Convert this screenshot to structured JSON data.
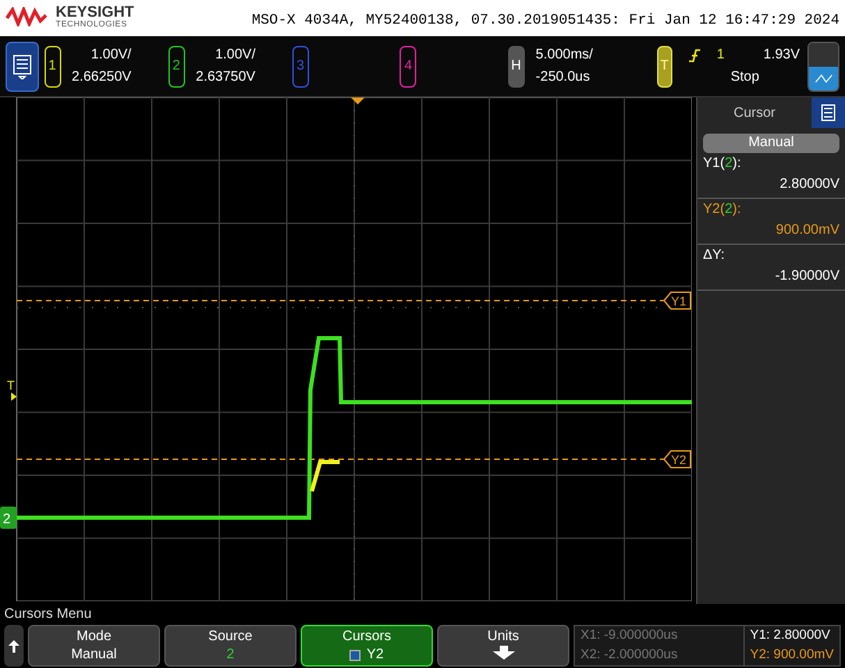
{
  "header": {
    "brand": "KEYSIGHT",
    "brand_sub": "TECHNOLOGIES",
    "title": "MSO-X 4034A, MY52400138, 07.30.2019051435: Fri Jan 12 16:47:29 2024"
  },
  "channels": [
    {
      "label": "1",
      "scale": "1.00V/",
      "offset": "2.66250V",
      "color": "#d8d800"
    },
    {
      "label": "2",
      "scale": "1.00V/",
      "offset": "2.63750V",
      "color": "#22c422"
    },
    {
      "label": "3",
      "color": "#3050e0"
    },
    {
      "label": "4",
      "color": "#e020a0"
    }
  ],
  "horizontal": {
    "label": "H",
    "scale": "5.000ms/",
    "delay": "-250.0us"
  },
  "trigger": {
    "label": "T",
    "source": "1",
    "level": "1.93V",
    "status": "Stop"
  },
  "plot": {
    "trigger_marker": "T",
    "ground_marker": "2",
    "cursors": [
      {
        "label": "Y1"
      },
      {
        "label": "Y2"
      }
    ]
  },
  "side_panel": {
    "title": "Cursor",
    "mode": "Manual",
    "readouts": [
      {
        "label": "Y1(",
        "source": "2",
        "close": "):",
        "value": "2.80000V",
        "color": "#ffffff"
      },
      {
        "label": "Y2(",
        "source": "2",
        "close": "):",
        "value": "900.00mV",
        "color": "#e89a1a"
      },
      {
        "label": "ΔY:",
        "value": "-1.90000V",
        "color": "#ffffff"
      }
    ]
  },
  "menu": {
    "title": "Cursors Menu",
    "softkeys": [
      {
        "kind": "value",
        "label": "Mode",
        "value": "Manual",
        "selected": false
      },
      {
        "kind": "value",
        "label": "Source",
        "value": "2",
        "selected": false
      },
      {
        "kind": "cursor",
        "label": "Cursors",
        "value": "Y2",
        "selected": true
      },
      {
        "kind": "arrow",
        "label": "Units",
        "selected": false
      }
    ],
    "x_readouts": [
      "X1: -9.000000us",
      "X2: -2.000000us"
    ],
    "y_readouts": [
      {
        "text": "Y1: 2.80000V",
        "color": "#ffffff"
      },
      {
        "text": "Y2: 900.00mV",
        "color": "#e89a1a"
      }
    ]
  }
}
